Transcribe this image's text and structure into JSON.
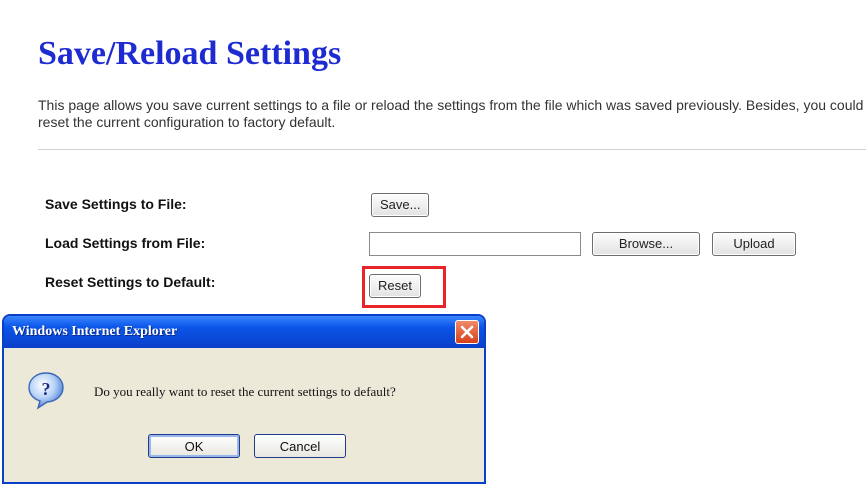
{
  "page": {
    "title": "Save/Reload Settings",
    "description": "This page allows you save current settings to a file or reload the settings from the file which was saved previously. Besides, you could reset the current configuration to factory default."
  },
  "rows": {
    "save": {
      "label": "Save Settings to File:",
      "button": "Save..."
    },
    "load": {
      "label": "Load Settings from File:",
      "file_value": "",
      "browse_button": "Browse...",
      "upload_button": "Upload"
    },
    "reset": {
      "label": "Reset Settings to Default:",
      "button": "Reset"
    }
  },
  "dialog": {
    "title": "Windows Internet Explorer",
    "message": "Do you really want to reset the current settings to default?",
    "ok_label": "OK",
    "cancel_label": "Cancel",
    "icon": "question-icon"
  },
  "colors": {
    "title": "#1d2bd1",
    "highlight": "#e8232a",
    "dialog_titlebar": "#0b55e8",
    "dialog_body": "#ece9d8"
  }
}
